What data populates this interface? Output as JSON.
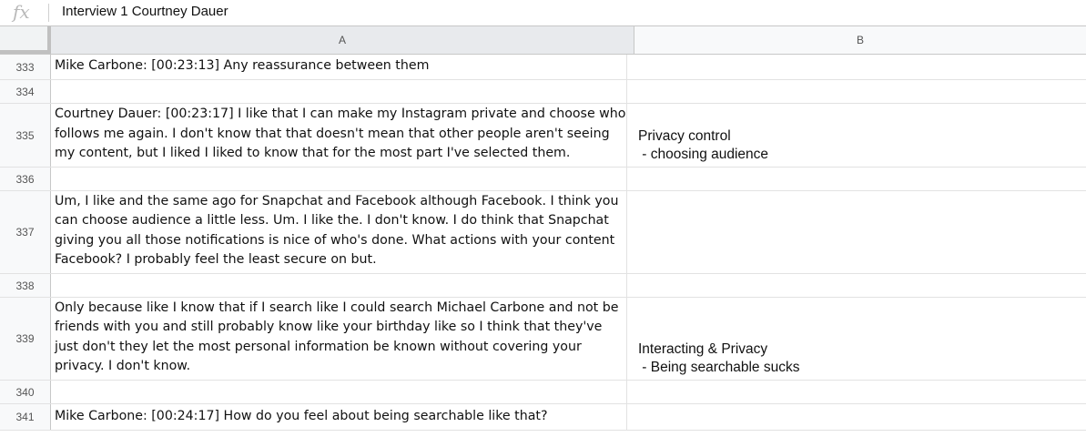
{
  "formula_bar": {
    "fx_label": "fx",
    "content": "Interview 1 Courtney Dauer"
  },
  "columns": [
    "A",
    "B"
  ],
  "rows": [
    {
      "num": "333",
      "a": "Mike Carbone: [00:23:13] Any reassurance between them",
      "b1": "",
      "b2": ""
    },
    {
      "num": "334",
      "a": "",
      "b1": "",
      "b2": ""
    },
    {
      "num": "335",
      "a": "Courtney Dauer: [00:23:17] I like that I can make my Instagram private and choose who follows me again. I don't know that that doesn't mean that other people aren't seeing my content, but I liked I liked to know that for the most part I've selected them.",
      "b1": "Privacy control",
      "b2": " - choosing audience"
    },
    {
      "num": "336",
      "a": "",
      "b1": "",
      "b2": ""
    },
    {
      "num": "337",
      "a": "Um, I like and the same ago for Snapchat and Facebook although Facebook. I think you can choose audience a little less. Um. I like the. I don't know. I do think that Snapchat giving you all those notifications is nice of who's done. What actions with your content Facebook? I probably feel the least secure on but.",
      "b1": "",
      "b2": ""
    },
    {
      "num": "338",
      "a": "",
      "b1": "",
      "b2": ""
    },
    {
      "num": "339",
      "a": "Only because like I know that if I search like I could search Michael Carbone and not be friends with you and still probably know like your birthday like so I think that they've just don't they let the most personal information be known without covering your privacy. I don't know.",
      "b1": "Interacting & Privacy",
      "b2": " - Being searchable sucks"
    },
    {
      "num": "340",
      "a": "",
      "b1": "",
      "b2": ""
    },
    {
      "num": "341",
      "a": "Mike Carbone: [00:24:17] How do you feel about being searchable like that?",
      "b1": "",
      "b2": ""
    }
  ]
}
